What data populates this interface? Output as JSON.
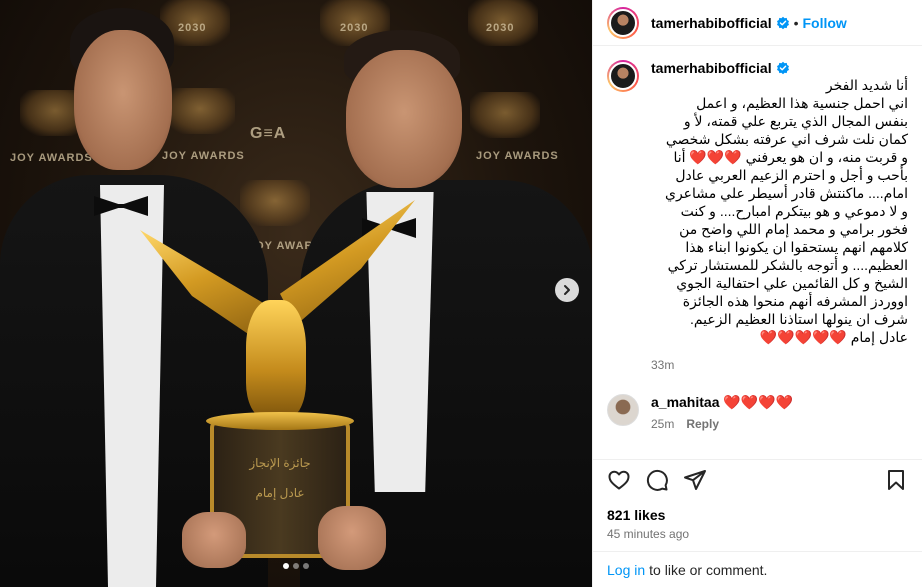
{
  "post": {
    "username": "tamerhabibofficial",
    "follow_label": "Follow",
    "header_separator": "•",
    "caption": "أنا شديد الفخر\nاني احمل جنسية هذا العظيم، و اعمل\nبنفس المجال الذي يتربع علي قمته، لأ و\nكمان نلت شرف اني عرفته بشكل شخصي\nو قربت منه، و ان هو يعرفني ❤️❤️❤️ أنا\nبأحب و أجل و احترم الزعيم العربي عادل\nامام.... ماكنتش قادر أسيطر علي مشاعري\nو لا دموعي و هو بيتكرم امبارح.... و كنت\nفخور برامي و محمد إمام اللي واضح من\nكلامهم انهم يستحقوا ان يكونوا ابناء هذا\nالعظيم.... و أتوجه بالشكر للمستشار تركي\nالشيخ و كل القائمين علي احتفالية الجوي\nاووردز المشرفه أنهم منحوا هذه الجائزة\nشرف ان ينولها استاذنا العظيم الزعيم.\nعادل إمام ❤️❤️❤️❤️❤️",
    "caption_age": "33m",
    "likes": "821 likes",
    "posted_ago": "45 minutes ago",
    "login_link": "Log in",
    "login_suffix": "to like or comment."
  },
  "comment": {
    "username": "a_mahitaa",
    "text": "❤️❤️❤️❤️",
    "age": "25m",
    "reply_label": "Reply"
  },
  "media": {
    "backdrop_texts": [
      "2030",
      "2030",
      "2030",
      "JOY AWARDS",
      "JOY AWARDS",
      "JOY AWARDS",
      "G≡A",
      "JOY AWARDS"
    ],
    "trophy_lines": [
      "جائزة الإنجاز",
      "عادل إمام"
    ],
    "carousel_dots": 3,
    "active_dot": 1
  },
  "icons": {
    "header": [
      "verified-badge-icon",
      "more-options-icon"
    ],
    "actions": [
      "like-heart-icon",
      "comment-bubble-icon",
      "share-send-icon",
      "save-bookmark-icon"
    ],
    "media": [
      "next-chevron-icon"
    ]
  },
  "colors": {
    "link_blue": "#0095f6",
    "heart_red": "#ed4956",
    "muted_gray": "#737373",
    "divider": "#efefef"
  }
}
